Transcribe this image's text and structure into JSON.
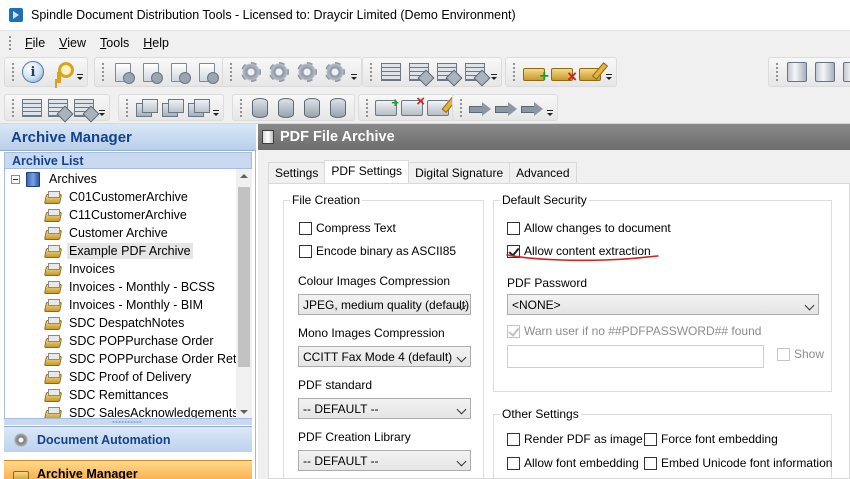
{
  "window": {
    "title": "Spindle Document Distribution Tools - Licensed to: Draycir Limited (Demo Environment)",
    "app_icon": "spindle-app-icon"
  },
  "menu": {
    "items": [
      {
        "label_key": "F",
        "label_rest": "ile"
      },
      {
        "label_key": "V",
        "label_rest": "iew"
      },
      {
        "label_key": "T",
        "label_rest": "ools"
      },
      {
        "label_key": "H",
        "label_rest": "elp"
      }
    ]
  },
  "toolbar": {
    "row1_icons": [
      "info-icon",
      "key-icon",
      "new-document-icon",
      "edit-document-icon",
      "copy-document-icon",
      "delete-document-icon",
      "gear-icon",
      "gear-add-icon",
      "gear-edit-icon",
      "gear-delete-icon",
      "grid-icon",
      "grid-delete-icon",
      "grid-edit-icon",
      "grid-move-icon",
      "archive-add-icon",
      "archive-delete-icon",
      "archive-edit-icon",
      "server-icon",
      "server-add-icon",
      "server-delete-icon"
    ],
    "row2_icons": [
      "barcode-icon",
      "barcode-delete-icon",
      "barcode-edit-icon",
      "cube-icon",
      "cube-delete-icon",
      "cube-edit-icon",
      "database-icon",
      "database-delete-icon",
      "database-edit-icon",
      "database-move-icon",
      "folder-add-icon",
      "folder-delete-icon",
      "folder-edit-icon",
      "arrow-add-icon",
      "arrow-delete-icon",
      "arrow-edit-icon"
    ]
  },
  "left_panel": {
    "title": "Archive Manager",
    "list_header": "Archive List",
    "root_label": "Archives",
    "archives": [
      "C01CustomerArchive",
      "C11CustomerArchive",
      "Customer Archive",
      "Example PDF Archive",
      "Invoices",
      "Invoices - Monthly - BCSS",
      "Invoices - Monthly - BIM",
      "SDC DespatchNotes",
      "SDC POPPurchase Order",
      "SDC POPPurchase Order Return",
      "SDC Proof of Delivery",
      "SDC Remittances",
      "SDC SalesAcknowledgements"
    ],
    "selected_archive": "Example PDF Archive",
    "nav": {
      "document_automation": "Document Automation",
      "archive_manager": "Archive Manager"
    }
  },
  "right_panel": {
    "title": "PDF File Archive",
    "tabs": [
      "Settings",
      "PDF Settings",
      "Digital Signature",
      "Advanced"
    ],
    "active_tab": "PDF Settings",
    "file_creation": {
      "legend": "File Creation",
      "compress_text": {
        "label": "Compress Text",
        "checked": false
      },
      "encode_binary": {
        "label": "Encode binary as ASCII85",
        "checked": false
      },
      "colour_images_label": "Colour Images Compression",
      "colour_images_value": "JPEG, medium quality (default)",
      "mono_images_label": "Mono Images Compression",
      "mono_images_value": "CCITT Fax Mode 4 (default)",
      "pdf_standard_label": "PDF standard",
      "pdf_standard_value": "-- DEFAULT --",
      "pdf_library_label": "PDF Creation Library",
      "pdf_library_value": "-- DEFAULT --"
    },
    "default_security": {
      "legend": "Default Security",
      "allow_changes": {
        "label": "Allow changes to document",
        "checked": false
      },
      "allow_extraction": {
        "label": "Allow content extraction",
        "checked": true
      },
      "pdf_password_label": "PDF Password",
      "pdf_password_value": "<NONE>",
      "warn_user": {
        "label": "Warn user if no ##PDFPASSWORD## found",
        "checked": true,
        "disabled": true
      },
      "password_input": "",
      "show": {
        "label": "Show",
        "checked": false,
        "disabled": true
      }
    },
    "other_settings": {
      "legend": "Other Settings",
      "render_pdf_as_image": {
        "label": "Render PDF as image",
        "checked": false
      },
      "force_font_embedding": {
        "label": "Force font embedding",
        "checked": false
      },
      "allow_font_embedding": {
        "label": "Allow font embedding",
        "checked": false
      },
      "embed_unicode": {
        "label": "Embed Unicode font information",
        "checked": false
      }
    },
    "annotation_color": "#d42020"
  }
}
